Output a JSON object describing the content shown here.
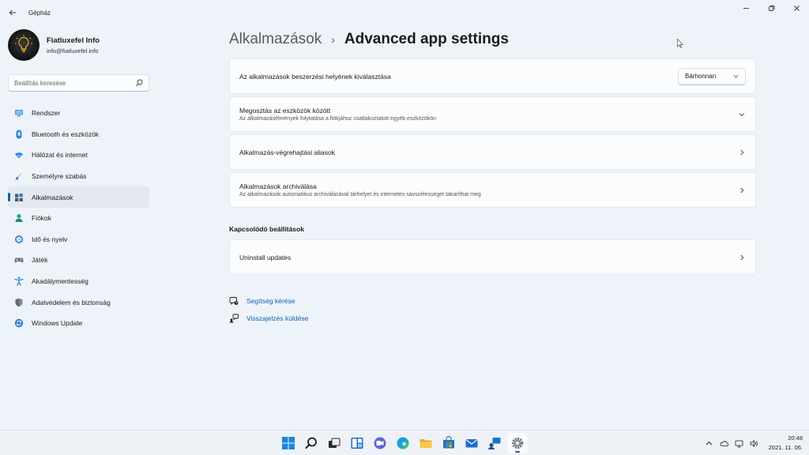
{
  "window": {
    "title": "Gépház",
    "back_icon": "back-arrow-icon",
    "controls": [
      "minimize-icon",
      "restore-icon",
      "close-icon"
    ]
  },
  "profile": {
    "name": "Fiatluxefel Info",
    "email": "info@fiatluxefel.info",
    "avatar_text": "Fiatluxefel Info"
  },
  "search": {
    "placeholder": "Beállítás keresése",
    "value": ""
  },
  "nav": {
    "items": [
      {
        "label": "Rendszer",
        "icon": "monitor-icon",
        "active": false
      },
      {
        "label": "Bluetooth és eszközök",
        "icon": "bluetooth-icon",
        "active": false
      },
      {
        "label": "Hálózat és internet",
        "icon": "wifi-icon",
        "active": false
      },
      {
        "label": "Személyre szabás",
        "icon": "brush-icon",
        "active": false
      },
      {
        "label": "Alkalmazások",
        "icon": "apps-icon",
        "active": true
      },
      {
        "label": "Fiókok",
        "icon": "person-icon",
        "active": false
      },
      {
        "label": "Idő és nyelv",
        "icon": "globe-clock-icon",
        "active": false
      },
      {
        "label": "Játék",
        "icon": "gamepad-icon",
        "active": false
      },
      {
        "label": "Akadálymentesség",
        "icon": "accessibility-icon",
        "active": false
      },
      {
        "label": "Adatvédelem és biztonság",
        "icon": "shield-icon",
        "active": false
      },
      {
        "label": "Windows Update",
        "icon": "update-icon",
        "active": false
      }
    ]
  },
  "breadcrumb": {
    "parent": "Alkalmazások",
    "separator": "›",
    "current": "Advanced app settings"
  },
  "settings": {
    "app_source": {
      "title": "Az alkalmazások beszerzési helyének kiválasztása",
      "selected": "Bárhonnan"
    },
    "sharing": {
      "title": "Megosztás az eszközök között",
      "subtitle": "Az alkalmazásélmények folytatása a fiókjához csatlakoztatott egyéb eszközökön"
    },
    "aliases": {
      "title": "Alkalmazás-végrehajtási aliasok"
    },
    "archive": {
      "title": "Alkalmazások archiválása",
      "subtitle": "Az alkalmazások automatikus archiválásával tárhelyet és internetes sávszélességet takaríthat meg"
    }
  },
  "related": {
    "title": "Kapcsolódó beállítások",
    "uninstall_updates": "Uninstall updates"
  },
  "links": {
    "help": "Segítség kérése",
    "feedback": "Visszajelzés küldése"
  },
  "taskbar": {
    "apps": [
      "windows-start-icon",
      "search-icon",
      "task-view-icon",
      "widgets-icon",
      "teams-chat-icon",
      "edge-icon",
      "file-explorer-icon",
      "store-icon",
      "mail-icon",
      "feedback-hub-icon",
      "settings-icon"
    ],
    "tray": [
      "chevron-up-icon",
      "onedrive-icon",
      "network-icon",
      "volume-icon"
    ],
    "time": "20:48",
    "date": "2021. 11. 06."
  },
  "colors": {
    "accent": "#0a5fb4",
    "background": "#eef3f9",
    "card": "#fbfcfd"
  }
}
